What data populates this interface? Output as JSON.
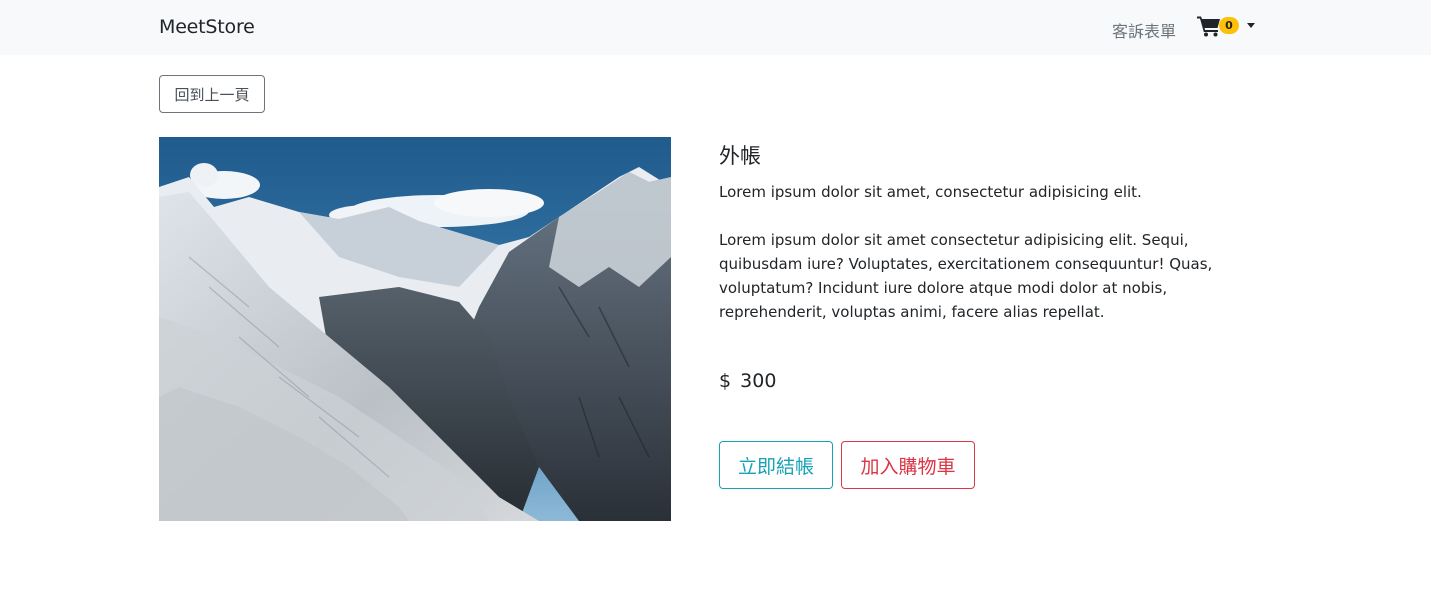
{
  "navbar": {
    "brand": "MeetStore",
    "links": [
      {
        "label": "客訴表單"
      }
    ],
    "cart": {
      "count": "0",
      "icon": "cart-icon",
      "badge_color": "#ffc107"
    },
    "background": "#f8f9fa"
  },
  "back_button": {
    "label": "回到上一頁"
  },
  "product": {
    "title": "外帳",
    "summary": "Lorem ipsum dolor sit amet, consectetur adipisicing elit.",
    "description": "Lorem ipsum dolor sit amet consectetur adipisicing elit. Sequi, quibusdam iure? Voluptates, exercitationem consequuntur! Quas, voluptatum? Incidunt iure dolore atque modi dolor at nobis, reprehenderit, voluptas animi, facere alias repellat.",
    "price_symbol": "$",
    "price": "300",
    "image": "snowy-mountain-valley-photo"
  },
  "actions": {
    "checkout": {
      "label": "立即結帳",
      "color": "#17a2b8"
    },
    "add_to_cart": {
      "label": "加入購物車",
      "color": "#dc3545"
    }
  }
}
